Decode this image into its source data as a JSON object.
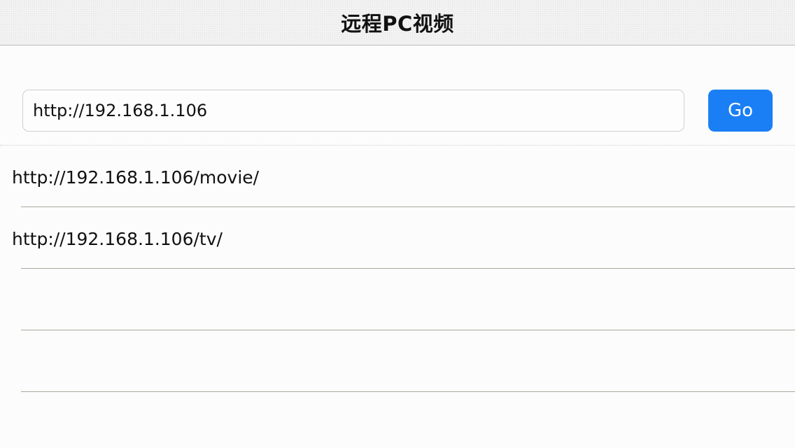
{
  "navbar": {
    "title": "远程PC视频"
  },
  "address_bar": {
    "value": "http://192.168.1.106",
    "go_label": "Go"
  },
  "history": {
    "items": [
      {
        "label": "http://192.168.1.106/movie/"
      },
      {
        "label": "http://192.168.1.106/tv/"
      },
      {
        "label": ""
      },
      {
        "label": ""
      }
    ]
  },
  "colors": {
    "accent": "#1a7ff5",
    "background": "#fcfcfc",
    "separator": "#a8ab9e"
  }
}
